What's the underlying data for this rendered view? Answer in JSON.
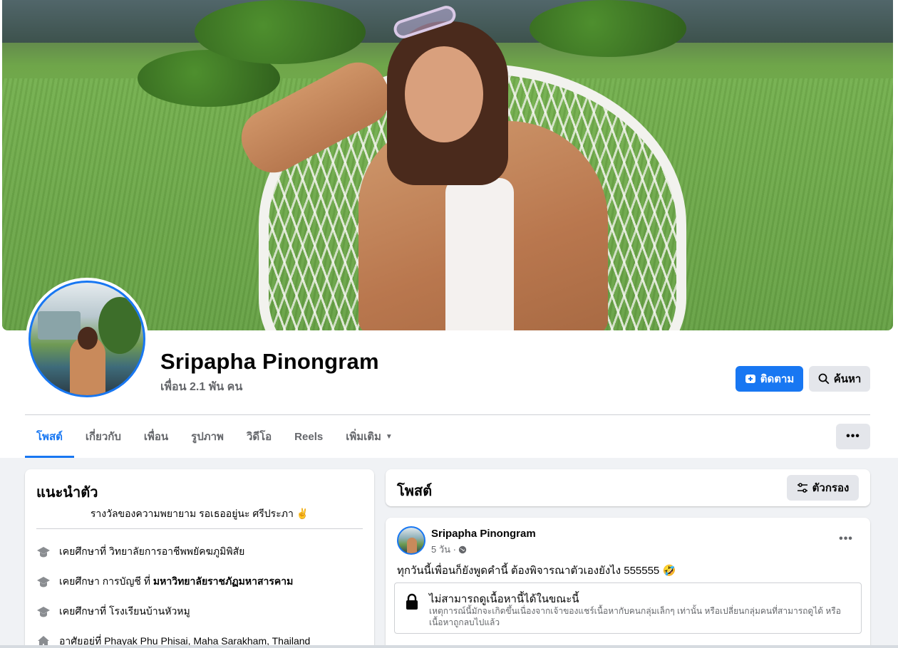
{
  "profile": {
    "name": "Sripapha Pinongram",
    "friends": "เพื่อน 2.1 พัน คน",
    "follow_label": "ติดตาม",
    "search_label": "ค้นหา"
  },
  "tabs": [
    {
      "label": "โพสต์"
    },
    {
      "label": "เกี่ยวกับ"
    },
    {
      "label": "เพื่อน"
    },
    {
      "label": "รูปภาพ"
    },
    {
      "label": "วิดีโอ"
    },
    {
      "label": "Reels"
    },
    {
      "label": "เพิ่มเติม"
    }
  ],
  "intro": {
    "title": "แนะนำตัว",
    "bio": "รางวัลของความพยายาม รอเธออยู่นะ ศรีประภา ✌️",
    "items": [
      {
        "prefix": "เคยศึกษาที่ ",
        "bold": "",
        "text": "วิทยาลัยการอาชีพพยัคฆภูมิพิสัย"
      },
      {
        "prefix": "เคยศึกษา การบัญชี ที่ ",
        "bold": "มหาวิทยาลัยราชภัฏมหาสารคาม",
        "text": ""
      },
      {
        "prefix": "เคยศึกษาที่ ",
        "bold": "",
        "text": "โรงเรียนบ้านหัวหมู"
      },
      {
        "prefix": "อาศัยอยู่ที่ ",
        "bold": "",
        "text": "Phayak Phu Phisai, Maha Sarakham, Thailand"
      }
    ]
  },
  "posts_section": {
    "title": "โพสต์",
    "filter_label": "ตัวกรอง"
  },
  "post": {
    "author": "Sripapha Pinongram",
    "time": "5 วัน ·",
    "text": "ทุกวันนี้เพื่อนก็ยังพูดคำนี้ ต้องพิจารณาตัวเองยังไง 555555 🤣",
    "unavailable_title": "ไม่สามารถดูเนื้อหานี้ได้ในขณะนี้",
    "unavailable_desc": "เหตุการณ์นี้มักจะเกิดขึ้นเนื่องจากเจ้าของแชร์เนื้อหากับคนกลุ่มเล็กๆ เท่านั้น หรือเปลี่ยนกลุ่มคนที่สามารถดูได้ หรือเนื้อหาถูกลบไปแล้ว"
  },
  "colors": {
    "accent": "#1877f2",
    "secondary_text": "#65676b",
    "page_bg": "#f0f2f5"
  },
  "icons": {
    "follow": "follow-plus-icon",
    "search": "search-icon",
    "more": "more-dots-icon",
    "filter": "filter-sliders-icon",
    "education": "graduation-cap-icon",
    "home": "home-icon",
    "privacy": "globe-icon",
    "lock": "lock-icon"
  }
}
